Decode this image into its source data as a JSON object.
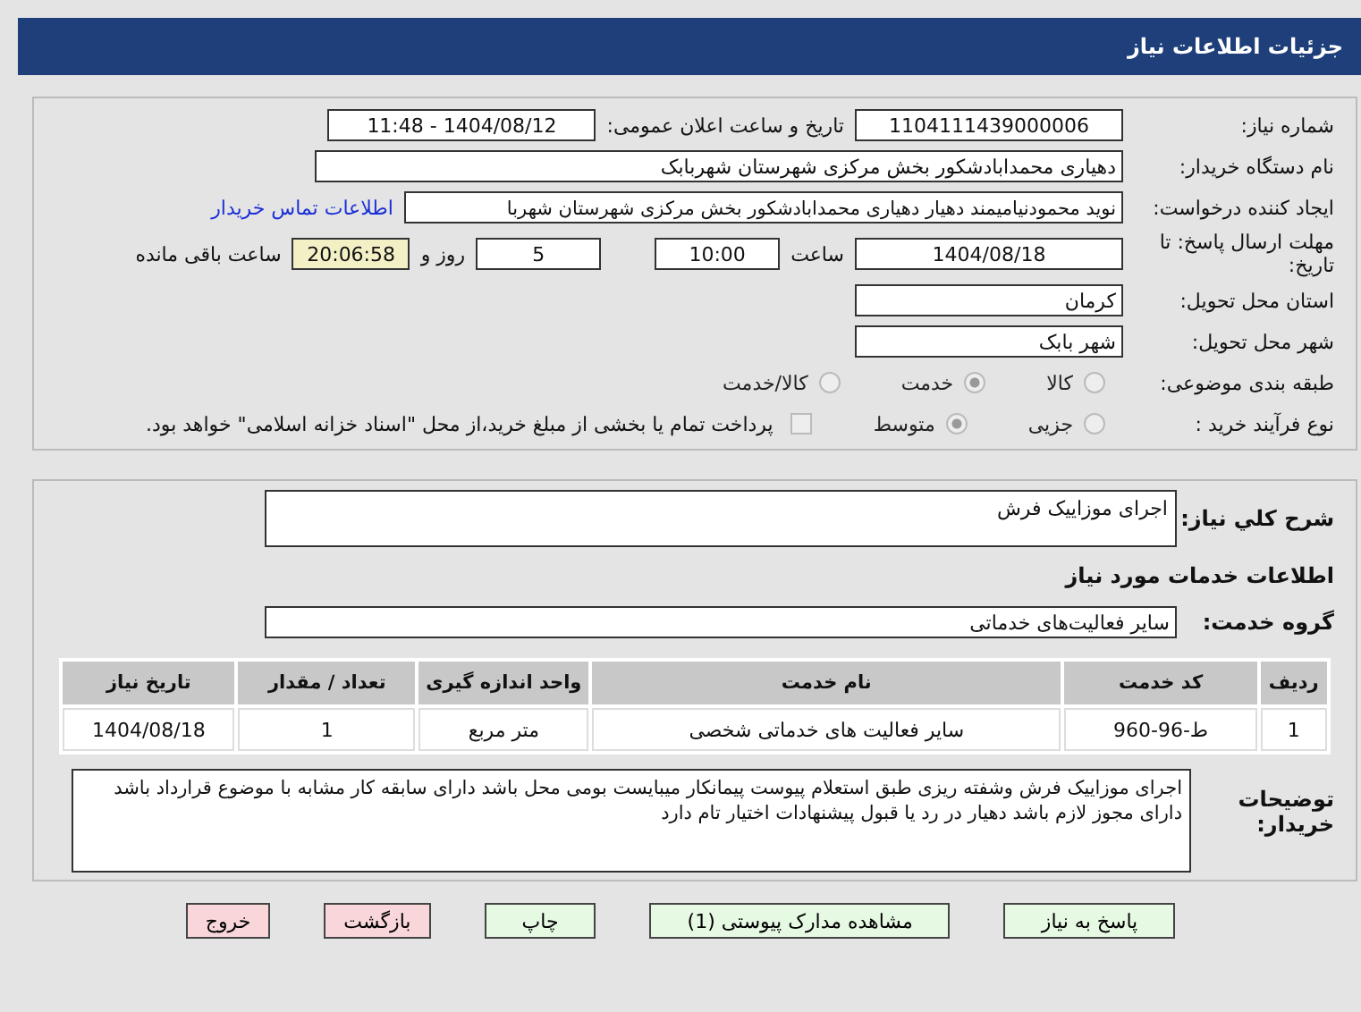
{
  "header": {
    "title": "جزئیات اطلاعات نیاز"
  },
  "need_number": {
    "label": "شماره نیاز:",
    "value": "1104111439000006"
  },
  "announce": {
    "label": "تاریخ و ساعت اعلان عمومی:",
    "value": "1404/08/12 - 11:48"
  },
  "buyer": {
    "label": "نام دستگاه خریدار:",
    "value": "دهیاری محمدابادشکور بخش مرکزی شهرستان شهربابک"
  },
  "requester": {
    "label": "ایجاد کننده درخواست:",
    "value": "نوید محمودنیامیمند دهیار دهیاری محمدابادشکور بخش مرکزی شهرستان شهربا",
    "link": "اطلاعات تماس خریدار"
  },
  "deadline": {
    "label": "مهلت ارسال پاسخ: تا تاریخ:",
    "date": "1404/08/18",
    "time_label": "ساعت",
    "time": "10:00",
    "days": "5",
    "days_label": "روز و",
    "remaining": "20:06:58",
    "remaining_label": "ساعت باقی مانده"
  },
  "province": {
    "label": "استان محل تحویل:",
    "value": "کرمان"
  },
  "city": {
    "label": "شهر محل تحویل:",
    "value": "شهر بابک"
  },
  "category": {
    "label": "طبقه بندی موضوعی:",
    "options": [
      {
        "label": "کالا",
        "selected": false
      },
      {
        "label": "خدمت",
        "selected": true
      },
      {
        "label": "کالا/خدمت",
        "selected": false
      }
    ]
  },
  "purchase_type": {
    "label": "نوع فرآیند خرید :",
    "options": [
      {
        "label": "جزیی",
        "selected": false
      },
      {
        "label": "متوسط",
        "selected": true
      }
    ],
    "payment": {
      "checked": false,
      "label": "پرداخت تمام یا بخشی از مبلغ خرید،از محل \"اسناد خزانه اسلامی\" خواهد بود."
    }
  },
  "summary": {
    "label": "شرح کلي نياز:",
    "value": "اجرای موزاییک فرش"
  },
  "services_title": "اطلاعات خدمات مورد نیاز",
  "service_group": {
    "label": "گروه خدمت:",
    "value": "سایر فعالیت‌های خدماتی"
  },
  "table": {
    "columns": [
      "ردیف",
      "کد خدمت",
      "نام خدمت",
      "واحد اندازه گیری",
      "تعداد / مقدار",
      "تاریخ نیاز"
    ],
    "rows": [
      [
        "1",
        "ط-96-960",
        "سایر فعالیت های خدماتی شخصی",
        "متر مربع",
        "1",
        "1404/08/18"
      ]
    ]
  },
  "buyer_notes": {
    "label": "توضیحات خریدار:",
    "value": "اجرای موزاییک فرش وشفته ریزی طبق استعلام پیوست پیمانکار میبایست بومی محل باشد دارای سابقه کار مشابه با موضوع قرارداد باشد دارای مجوز لازم باشد دهیار در رد یا قبول پیشنهادات اختیار تام دارد"
  },
  "buttons": [
    {
      "label": "پاسخ به نیاز",
      "kind": "green"
    },
    {
      "label": "مشاهده مدارک پیوستی (1)",
      "kind": "green"
    },
    {
      "label": "چاپ",
      "kind": "green"
    },
    {
      "label": "بازگشت",
      "kind": "red"
    },
    {
      "label": "خروج",
      "kind": "red"
    }
  ]
}
